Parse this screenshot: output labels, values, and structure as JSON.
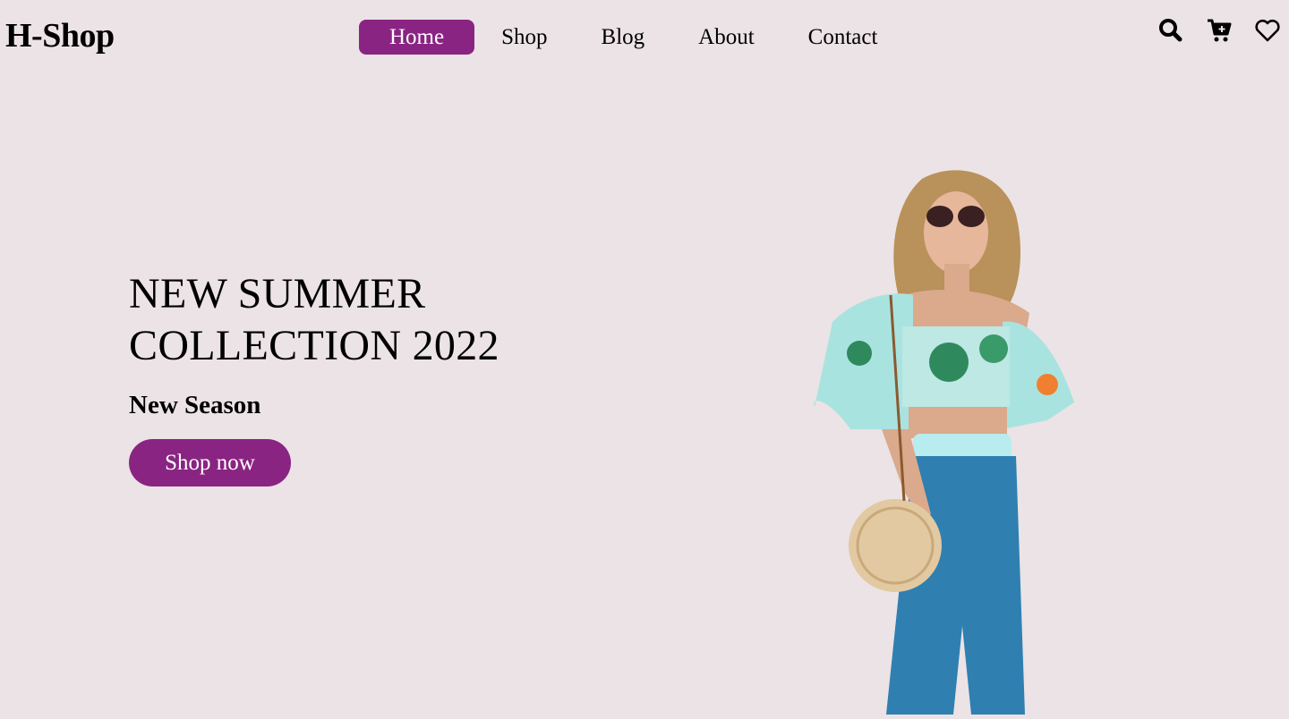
{
  "brand": {
    "logo_text": "H-Shop",
    "accent_color": "#8a2483",
    "background_color": "#ebe3e5"
  },
  "nav": {
    "items": [
      {
        "label": "Home",
        "active": true
      },
      {
        "label": "Shop",
        "active": false
      },
      {
        "label": "Blog",
        "active": false
      },
      {
        "label": "About",
        "active": false
      },
      {
        "label": "Contact",
        "active": false
      }
    ]
  },
  "header_icons": [
    "search-icon",
    "cart-icon",
    "heart-icon"
  ],
  "hero": {
    "title_line1": "NEW SUMMER",
    "title_line2": "COLLECTION 2022",
    "subtitle": "New Season",
    "cta_label": "Shop now"
  }
}
